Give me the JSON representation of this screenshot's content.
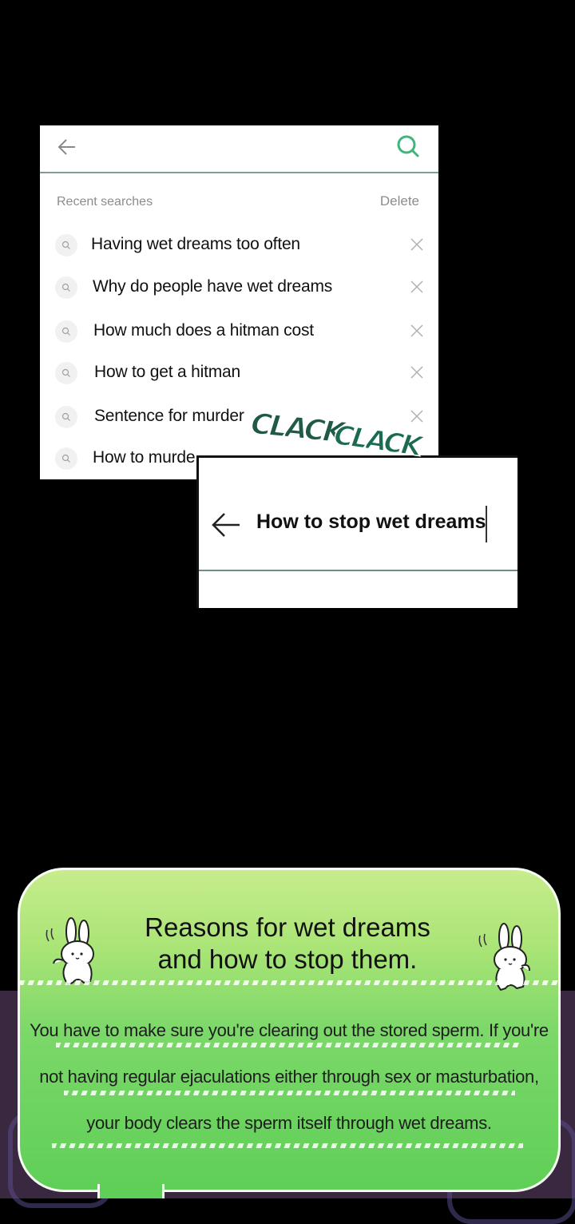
{
  "search_history": {
    "recent_label": "Recent searches",
    "delete_label": "Delete",
    "items": [
      {
        "text": "Having wet dreams too often"
      },
      {
        "text": "Why do people have wet dreams"
      },
      {
        "text": "How much does a hitman cost"
      },
      {
        "text": "How to get a hitman"
      },
      {
        "text": "Sentence for murder"
      },
      {
        "text": "How to murde"
      }
    ]
  },
  "sound_effect": {
    "first": "CLACK",
    "second": "CLACK"
  },
  "search_input": {
    "query": "How to stop wet dreams"
  },
  "info_card": {
    "title_line1": "Reasons for wet dreams",
    "title_line2": "and how to stop them.",
    "body_line1": "You have to make sure you're clearing out the stored sperm. If you're",
    "body_line2": "not having regular ejaculations either through sex or masturbation,",
    "body_line3": "your body clears the sperm itself through wet dreams."
  },
  "colors": {
    "accent_green": "#3fb57c",
    "card_green": "#7cd869",
    "divider": "#7f9c97"
  }
}
